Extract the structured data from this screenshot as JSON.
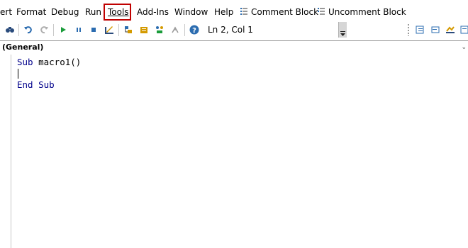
{
  "menu": {
    "insert_partial": "ert",
    "format": "Format",
    "debug": "Debug",
    "run": "Run",
    "tools": "Tools",
    "addins": "Add-Ins",
    "window": "Window",
    "help": "Help",
    "comment_block": "Comment Block",
    "uncomment_block": "Uncomment Block",
    "highlight_color": "#c00000"
  },
  "toolbar": {
    "icons": [
      "find-icon",
      "undo-icon",
      "redo-icon",
      "run-icon",
      "break-icon",
      "reset-icon",
      "design-mode-icon",
      "project-explorer-icon",
      "properties-icon",
      "object-browser-icon",
      "toolbox-icon",
      "help-icon",
      "indent-icon",
      "outdent-icon",
      "toggle-breakpoint-icon",
      "comment-icon"
    ],
    "position": "Ln 2, Col 1"
  },
  "object_combo": {
    "value": "(General)"
  },
  "code": {
    "line1_kw": "Sub",
    "line1_rest": " macro1()",
    "line3_kw1": "End",
    "line3_kw2": " Sub",
    "keyword_color": "#00008b"
  }
}
